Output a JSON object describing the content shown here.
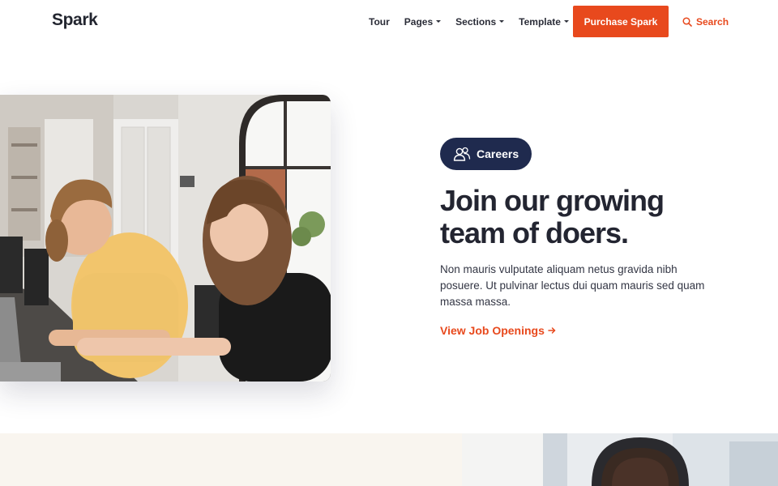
{
  "header": {
    "logo": "Spark",
    "nav": [
      {
        "label": "Tour",
        "dropdown": false
      },
      {
        "label": "Pages",
        "dropdown": true
      },
      {
        "label": "Sections",
        "dropdown": true
      },
      {
        "label": "Template",
        "dropdown": true
      }
    ],
    "purchase_label": "Purchase Spark",
    "search_label": "Search",
    "search_icon": "search-icon"
  },
  "hero": {
    "badge_icon": "people-icon",
    "badge_label": "Careers",
    "title_line1": "Join our growing",
    "title_line2": "team of doers.",
    "body": "Non mauris vulputate aliquam netus gravida nibh posuere. Ut pulvinar lectus dui quam mauris sed quam massa massa.",
    "link_label": "View Job Openings",
    "link_icon": "arrow-right-icon"
  },
  "colors": {
    "accent": "#e8491d",
    "badge_bg": "#1f2a4e",
    "heading": "#232531",
    "section_band": "#f9f5ef"
  }
}
